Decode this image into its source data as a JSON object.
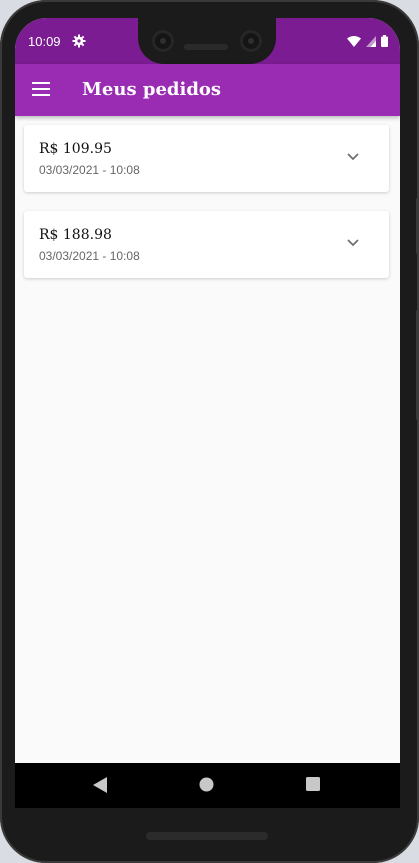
{
  "status_bar": {
    "time": "10:09",
    "icons": [
      "gear-icon",
      "wifi-icon",
      "signal-icon",
      "battery-icon"
    ]
  },
  "app_bar": {
    "title": "Meus pedidos",
    "menu_icon": "menu-icon"
  },
  "orders": [
    {
      "amount": "R$ 109.95",
      "date": "03/03/2021 - 10:08",
      "icon": "chevron-down-icon"
    },
    {
      "amount": "R$ 188.98",
      "date": "03/03/2021 - 10:08",
      "icon": "chevron-down-icon"
    }
  ],
  "nav_bar": {
    "buttons": [
      "back-icon",
      "home-icon",
      "recents-icon"
    ]
  },
  "colors": {
    "app_bar": "#9a2bb3",
    "status_bar": "#7b1c92",
    "background": "#fafafa"
  }
}
